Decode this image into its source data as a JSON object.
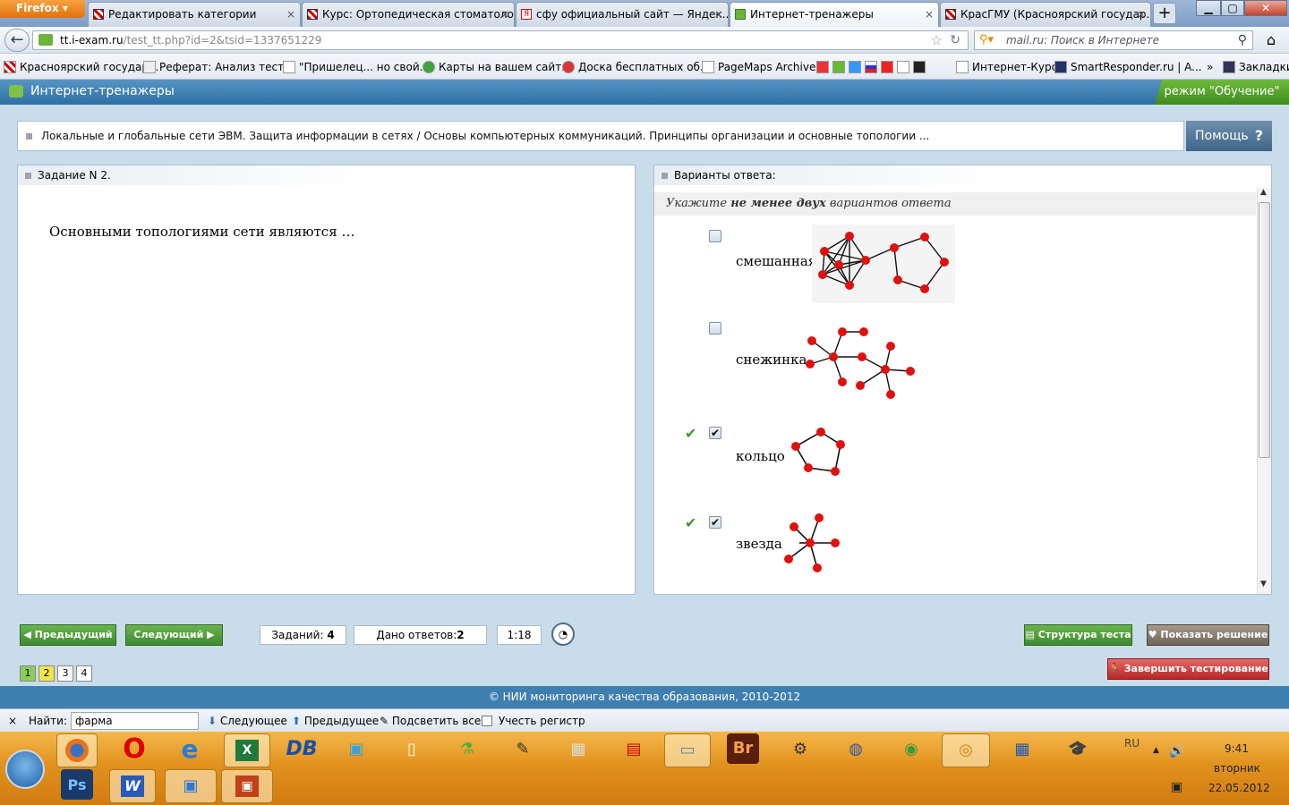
{
  "browser": {
    "menu_label": "Firefox",
    "tabs": [
      {
        "title": "Редактировать категории"
      },
      {
        "title": "Курс: Ортопедическая стоматоло..."
      },
      {
        "title": "сфу официальный сайт — Яндек..."
      },
      {
        "title": "Интернет-тренажеры"
      },
      {
        "title": "КрасГМУ (Красноярский государ..."
      }
    ],
    "new_tab": "+",
    "close_tab": "×",
    "url_domain": "tt.i-exam.ru",
    "url_path": "/test_tt.php?id=2&tsid=1337651229",
    "search_placeholder": "mail.ru: Поиск в Интернете",
    "bookmarks": [
      {
        "label": "Красноярский государ..."
      },
      {
        "label": "Реферат: Анализ тест..."
      },
      {
        "label": "\"Пришелец... но свой..."
      },
      {
        "label": "Карты на вашем сайт..."
      },
      {
        "label": "Доска бесплатных об..."
      },
      {
        "label": "PageMaps Archives"
      },
      {
        "label": "Интернет-Курс"
      },
      {
        "label": "SmartResponder.ru | A..."
      }
    ],
    "bookmarks_more": "»",
    "bookmarks_menu": "Закладки"
  },
  "app": {
    "title": "Интернет-тренажеры",
    "mode": "режим \"Обучение\"",
    "breadcrumb": "Локальные и глобальные сети ЭВМ. Защита информации в сетях / Основы компьютерных коммуникаций. Принципы организации и основные топологии ...",
    "help_label": "Помощь",
    "help_icon": "?",
    "task_title": "Задание N 2.",
    "question": "Основными топологиями сети являются …",
    "answers_title": "Варианты ответа:",
    "hint_pre": "Укажите ",
    "hint_bold": "не менее двух",
    "hint_post": " вариантов ответа",
    "options": [
      {
        "label": "смешанная",
        "checked": false,
        "correct": false
      },
      {
        "label": "снежинка",
        "checked": false,
        "correct": false
      },
      {
        "label": "кольцо",
        "checked": true,
        "correct": true
      },
      {
        "label": "звезда",
        "checked": true,
        "correct": true
      }
    ]
  },
  "footer": {
    "prev_label": "Предыдущий",
    "next_label": "Следующий",
    "tasks_label": "Заданий:",
    "tasks_count": "4",
    "answered_label": "Дано ответов:",
    "answered_count": "2",
    "timer": "1:18",
    "structure_label": "Структура теста",
    "solution_label": "Показать решение",
    "finish_label": "Завершить тестирование",
    "pages": [
      "1",
      "2",
      "3",
      "4"
    ],
    "copyright": "© НИИ мониторинга качества образования, 2010-2012"
  },
  "findbar": {
    "close": "×",
    "label": "Найти:",
    "value": "фарма",
    "next_label": "Следующее",
    "prev_label": "Предыдущее",
    "highlight_label": "Подсветить все",
    "case_label": "Учесть регистр"
  },
  "taskbar": {
    "lang": "RU",
    "time": "9:41",
    "day": "вторник",
    "date": "22.05.2012"
  },
  "colors": {
    "accent_blue": "#3f7fb0",
    "green": "#4a9a35",
    "node_red": "#e01010"
  }
}
